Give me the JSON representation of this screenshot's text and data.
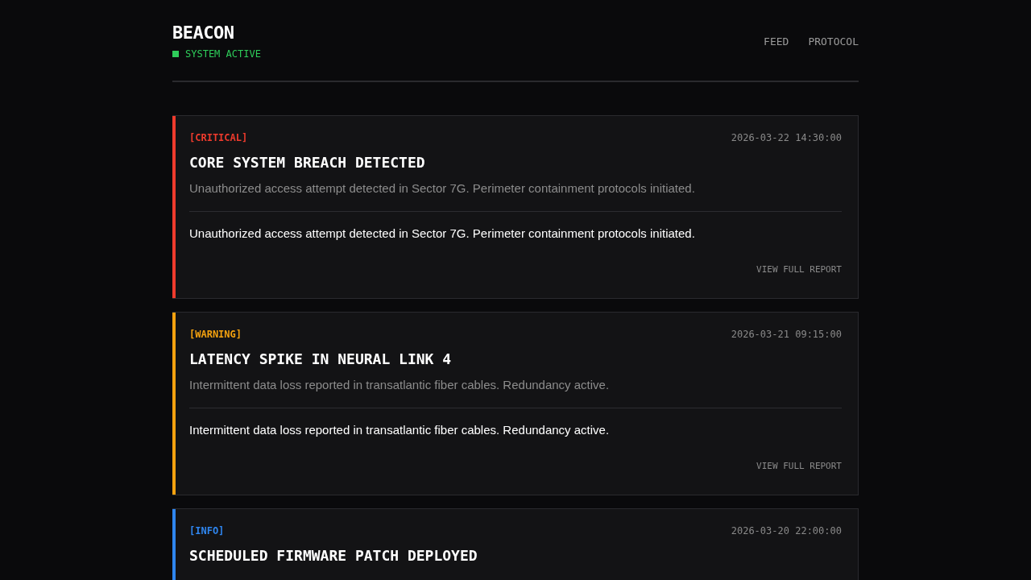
{
  "brand": {
    "title": "BEACON",
    "status": "SYSTEM ACTIVE",
    "active": true
  },
  "nav": [
    {
      "label": "FEED"
    },
    {
      "label": "PROTOCOL"
    }
  ],
  "alerts": [
    {
      "tag": "[CRITICAL]",
      "color": "#ef3b2d",
      "timestamp": "2026-03-22 14:30:00",
      "title": "CORE SYSTEM BREACH DETECTED",
      "summary": "Unauthorized access attempt detected in Sector 7G. Perimeter containment protocols initiated.",
      "details": "Unauthorized access attempt detected in Sector 7G. Perimeter containment protocols initiated.",
      "link": "VIEW FULL REPORT"
    },
    {
      "tag": "[WARNING]",
      "color": "#f5a20f",
      "timestamp": "2026-03-21 09:15:00",
      "title": "LATENCY SPIKE IN NEURAL LINK 4",
      "summary": "Intermittent data loss reported in transatlantic fiber cables. Redundancy active.",
      "details": "Intermittent data loss reported in transatlantic fiber cables. Redundancy active.",
      "link": "VIEW FULL REPORT"
    },
    {
      "tag": "[INFO]",
      "color": "#2f86f0",
      "timestamp": "2026-03-20 22:00:00",
      "title": "SCHEDULED FIRMWARE PATCH DEPLOYED"
    }
  ]
}
